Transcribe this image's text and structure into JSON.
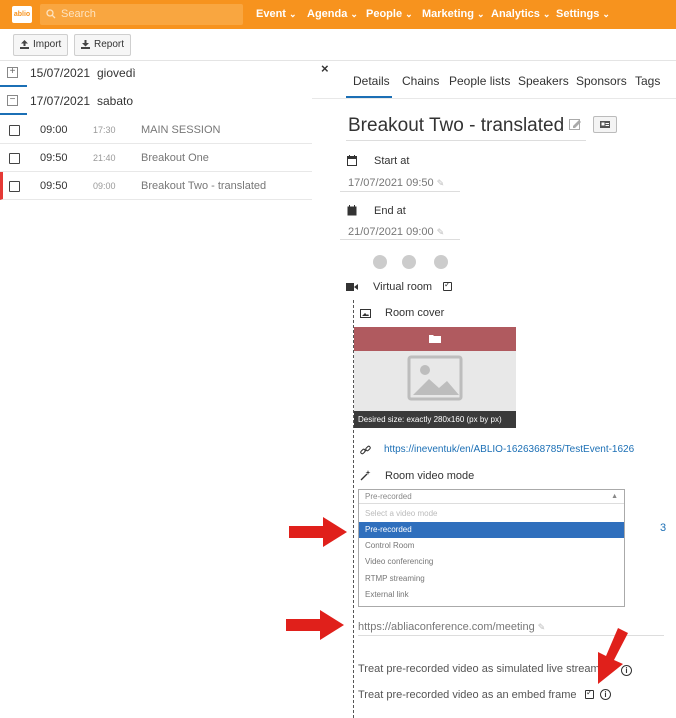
{
  "logo_text": "ablio",
  "search": {
    "placeholder": "Search"
  },
  "nav": [
    {
      "label": "Event"
    },
    {
      "label": "Agenda"
    },
    {
      "label": "People"
    },
    {
      "label": "Marketing"
    },
    {
      "label": "Analytics"
    },
    {
      "label": "Settings"
    }
  ],
  "toolbar": {
    "import_label": "Import",
    "report_label": "Report"
  },
  "days": [
    {
      "date": "15/07/2021",
      "weekday": "giovedì",
      "expanded": false
    },
    {
      "date": "17/07/2021",
      "weekday": "sabato",
      "expanded": true
    }
  ],
  "sessions": [
    {
      "start": "09:00",
      "end": "17:30",
      "title": "MAIN SESSION"
    },
    {
      "start": "09:50",
      "end": "21:40",
      "title": "Breakout One"
    },
    {
      "start": "09:50",
      "end": "09:00",
      "title": "Breakout Two - translated"
    }
  ],
  "detail": {
    "close": "×",
    "tabs": [
      "Details",
      "Chains",
      "People lists",
      "Speakers",
      "Sponsors",
      "Tags"
    ],
    "title": "Breakout Two - translated",
    "start_label": "Start at",
    "start_value": "17/07/2021 09:50",
    "end_label": "End at",
    "end_value": "21/07/2021 09:00",
    "virtual_room_label": "Virtual room",
    "room_cover_label": "Room cover",
    "cover_hint": "Desired size: exactly 280x160 (px by px)",
    "link_url": "https://ineventuk/en/ABLIO-1626368785/TestEvent-1626",
    "video_mode_label": "Room video mode",
    "dropdown": {
      "selected": "Pre-recorded",
      "options": [
        "Select a video mode",
        "Pre-recorded",
        "Control Room",
        "Video conferencing",
        "RTMP streaming",
        "External link"
      ]
    },
    "side_number": "3",
    "meeting_url": "https://abliaconference.com/meeting",
    "simulated_label": "Treat pre-recorded video as simulated live stream",
    "embed_label": "Treat pre-recorded video as an embed frame",
    "embed_checked": true
  },
  "colors": {
    "brand": "#f7931e",
    "link": "#1b6fb5",
    "highlight": "#2f6fbd",
    "arrow": "#e0201b"
  }
}
